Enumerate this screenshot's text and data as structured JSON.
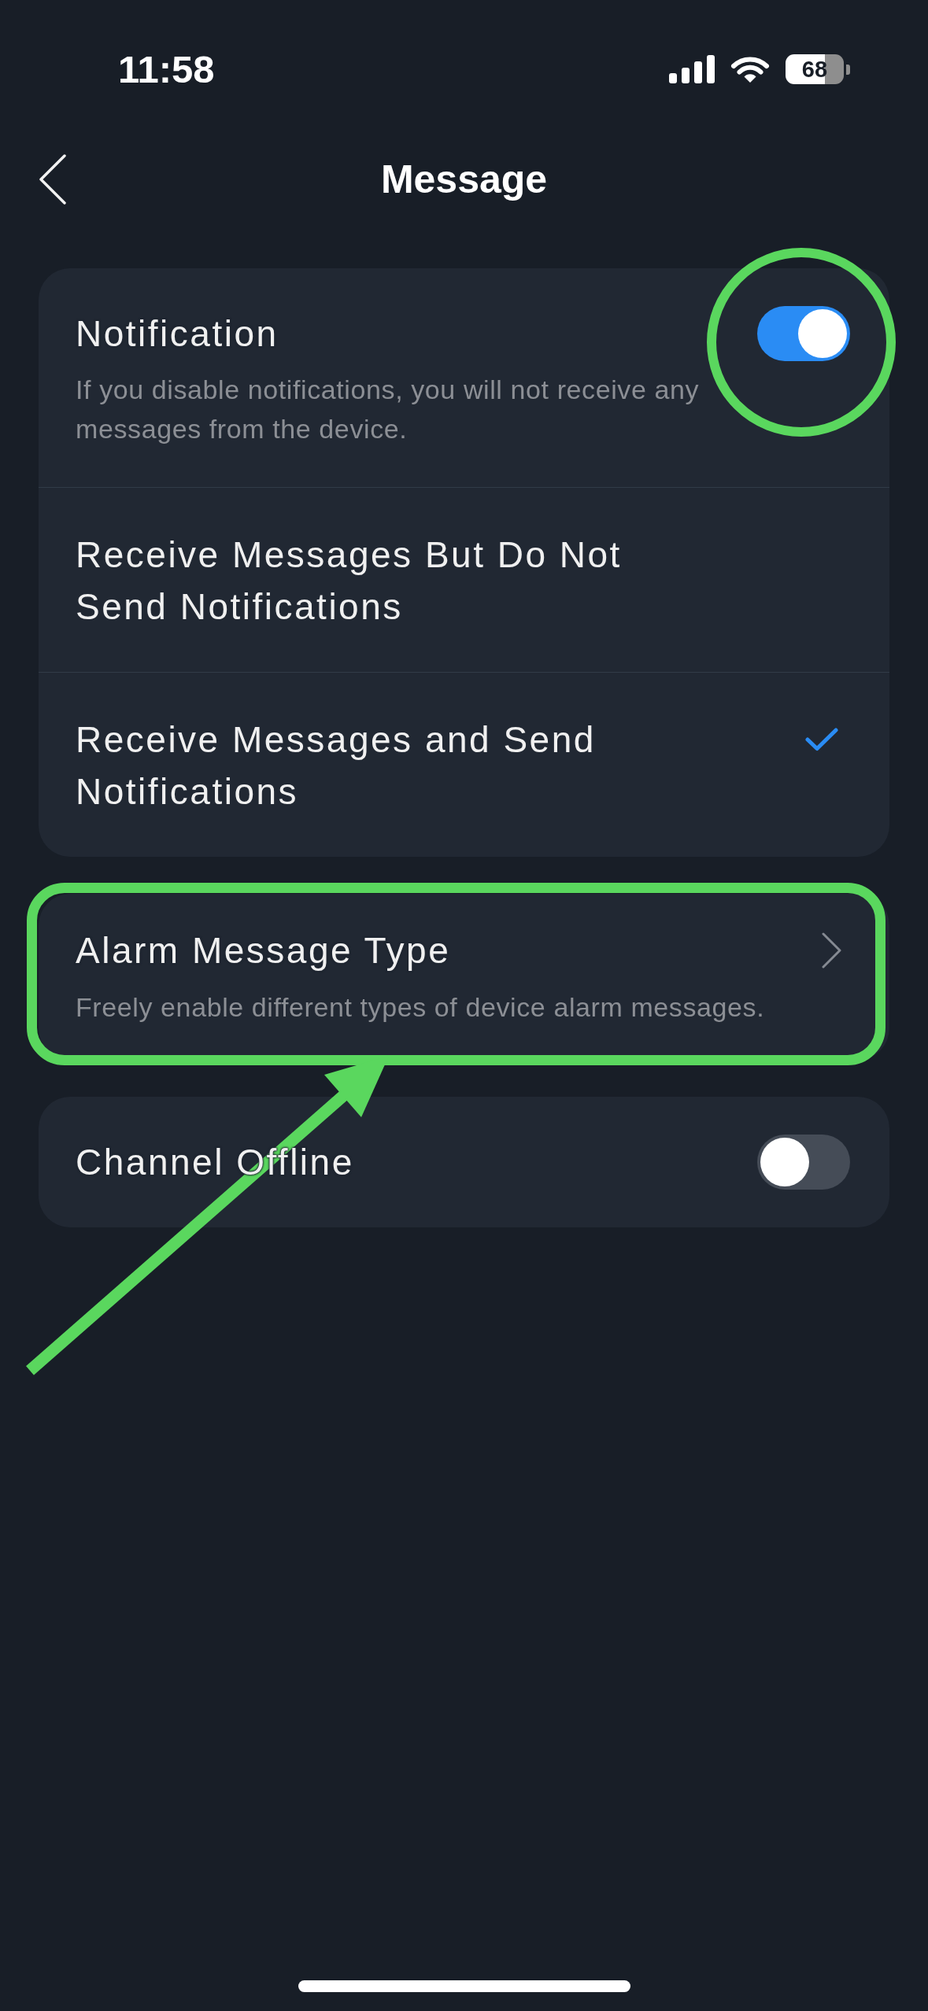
{
  "status_bar": {
    "time": "11:58",
    "battery": "68"
  },
  "nav": {
    "title": "Message"
  },
  "cards": [
    {
      "rows": [
        {
          "kind": "toggle",
          "title": "Notification",
          "description": "If you disable notifications, you will not receive any messages from the device.",
          "on": true
        },
        {
          "kind": "option",
          "title": "Receive Messages But Do Not Send Notifications",
          "selected": false
        },
        {
          "kind": "option",
          "title": "Receive Messages and Send Notifications",
          "selected": true
        }
      ]
    },
    {
      "rows": [
        {
          "kind": "link",
          "title": "Alarm Message Type",
          "description": "Freely enable different types of device alarm messages."
        }
      ]
    },
    {
      "rows": [
        {
          "kind": "toggle",
          "title": "Channel Offline",
          "on": false
        }
      ]
    }
  ],
  "annotations": [
    {
      "kind": "circle"
    },
    {
      "kind": "frame"
    },
    {
      "kind": "arrow"
    }
  ]
}
